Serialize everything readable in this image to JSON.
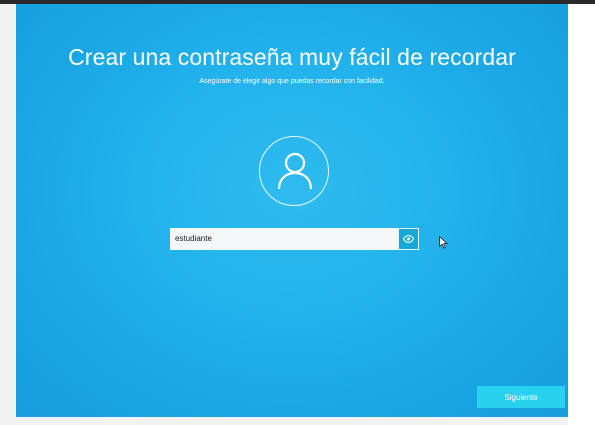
{
  "setup": {
    "title": "Crear una contraseña muy fácil de recordar",
    "subtitle": "Asegúrate de elegir algo que puedas recordar con facilidad.",
    "password_value": "estudiante",
    "next_label": "Siguiente"
  },
  "icons": {
    "avatar": "user-silhouette-icon",
    "reveal": "eye-icon",
    "cursor": "mouse-pointer-icon"
  },
  "colors": {
    "background": "#22b2ec",
    "next_button": "#28d2ee",
    "reveal_button": "#16a8d6",
    "text": "#ffffff"
  }
}
